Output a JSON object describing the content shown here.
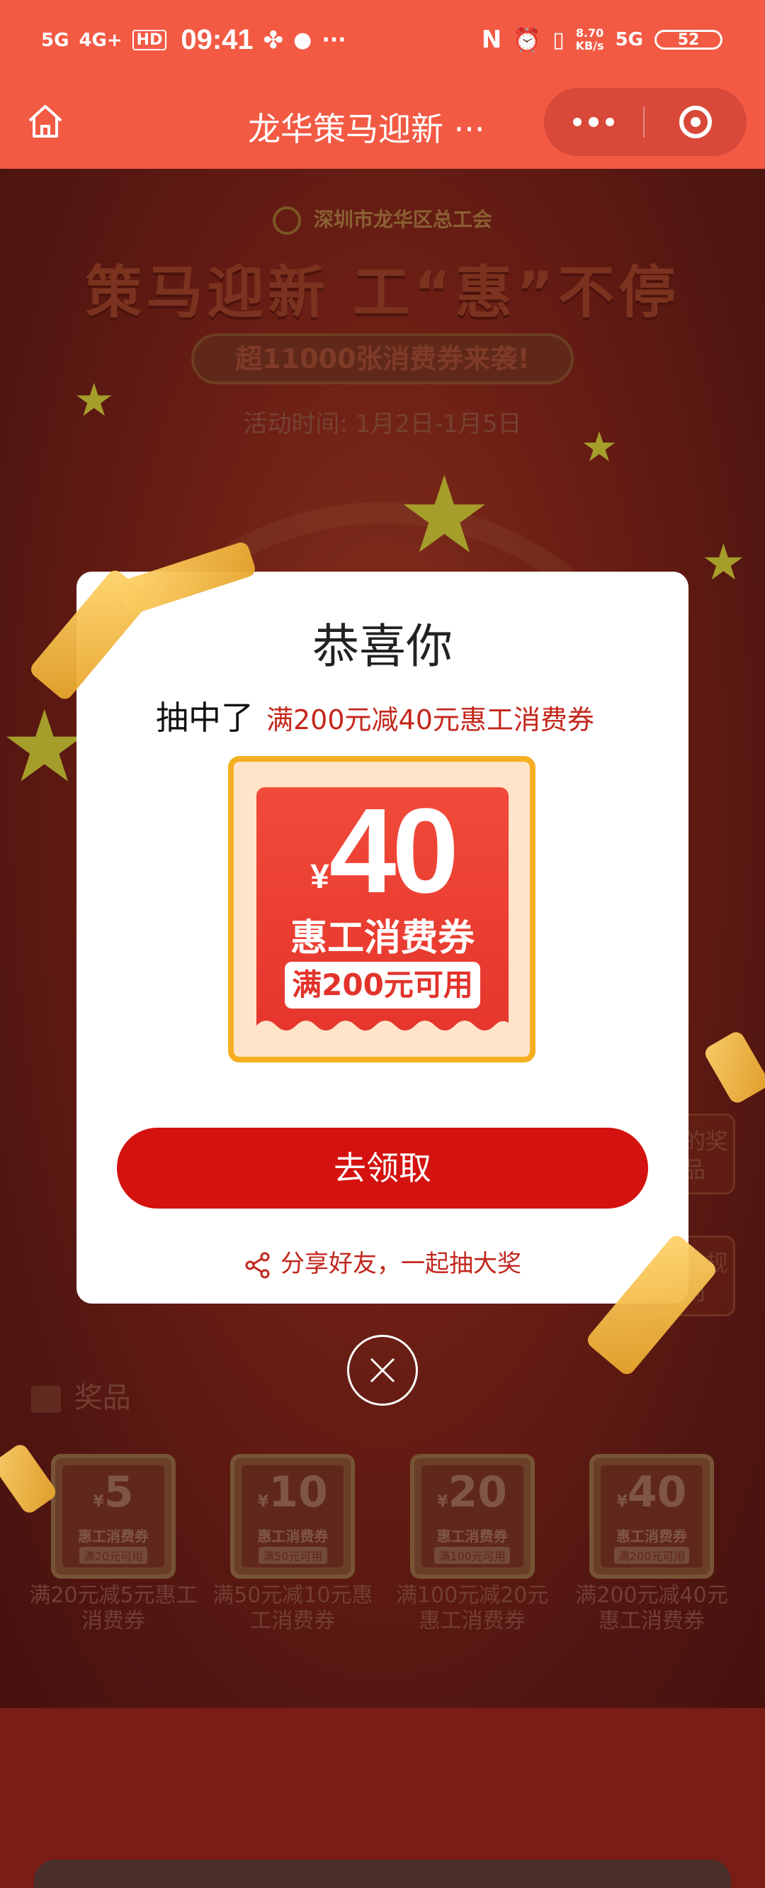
{
  "status_bar": {
    "signal1": "5G",
    "signal2": "4G+",
    "hd": "HD",
    "time": "09:41",
    "more": "···",
    "net_speed_value": "8.70",
    "net_speed_unit": "KB/s",
    "network": "5G",
    "battery": "52"
  },
  "nav": {
    "title": "龙华策马迎新 ···"
  },
  "background": {
    "org": "深圳市龙华区总工会",
    "headline": "策马迎新 工“惠”不停",
    "pill": "超11000张消费券来袭!",
    "activity_time": "活动时间: 1月2日-1月5日",
    "side_btn_1": "我的奖品",
    "side_btn_2": "活动规则",
    "prizes_title": "奖品",
    "prizes": [
      {
        "amount": "5",
        "label": "惠工消费券",
        "cond": "满20元可用",
        "name": "满20元减5元惠工消费券"
      },
      {
        "amount": "10",
        "label": "惠工消费券",
        "cond": "满50元可用",
        "name": "满50元减10元惠工消费券"
      },
      {
        "amount": "20",
        "label": "惠工消费券",
        "cond": "满100元可用",
        "name": "满100元减20元惠工消费券"
      },
      {
        "amount": "40",
        "label": "惠工消费券",
        "cond": "满200元可用",
        "name": "满200元减40元惠工消费券"
      }
    ]
  },
  "modal": {
    "title": "恭喜你",
    "won_prefix": "抽中了",
    "won_prize": "满200元减40元惠工消费券",
    "coupon": {
      "currency": "¥",
      "amount": "40",
      "label": "惠工消费券",
      "condition": "满200元可用"
    },
    "claim_button": "去领取",
    "share_text": "分享好友，一起抽大奖"
  },
  "colors": {
    "brand_red": "#f25a44",
    "button_red": "#d4120f",
    "coupon_border": "#f6ae21",
    "prize_text_red": "#c4271b"
  }
}
